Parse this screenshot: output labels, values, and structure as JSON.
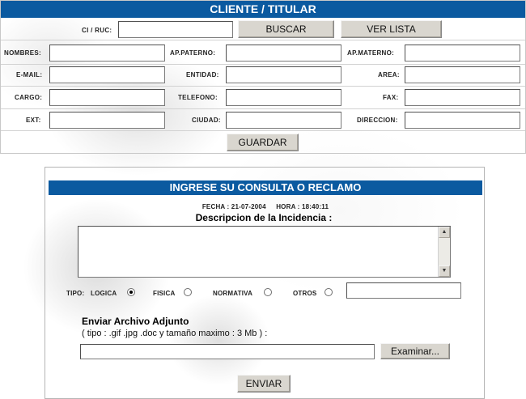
{
  "cliente": {
    "title": "CLIENTE / TITULAR",
    "ci_ruc_label": "CI / RUC:",
    "ci_ruc_value": "",
    "buscar_label": "BUSCAR",
    "ver_lista_label": "VER LISTA",
    "fields": {
      "nombres": "NOMBRES:",
      "ap_paterno": "AP.PATERNO:",
      "ap_materno": "AP.MATERNO:",
      "email": "E-MAIL:",
      "entidad": "ENTIDAD:",
      "area": "AREA:",
      "cargo": "CARGO:",
      "telefono": "TELEFONO:",
      "fax": "FAX:",
      "ext": "EXT:",
      "ciudad": "CIUDAD:",
      "direccion": "DIRECCION:"
    },
    "guardar_label": "GUARDAR"
  },
  "consulta": {
    "title": "INGRESE SU CONSULTA O RECLAMO",
    "fecha_label": "FECHA : 21-07-2004",
    "hora_label": "HORA : 18:40:11",
    "descripcion_label": "Descripcion de la Incidencia :",
    "descripcion_value": "",
    "tipo_label": "TIPO:",
    "tipos": [
      {
        "label": "LOGICA",
        "selected": true
      },
      {
        "label": "FISICA",
        "selected": false
      },
      {
        "label": "NORMATIVA",
        "selected": false
      },
      {
        "label": "OTROS",
        "selected": false
      }
    ],
    "otros_value": "",
    "adjunto_title": "Enviar Archivo Adjunto",
    "adjunto_info": "( tipo : .gif .jpg .doc y tamaño maximo : 3 Mb ) :",
    "file_value": "",
    "examinar_label": "Examinar...",
    "enviar_label": "ENVIAR"
  }
}
